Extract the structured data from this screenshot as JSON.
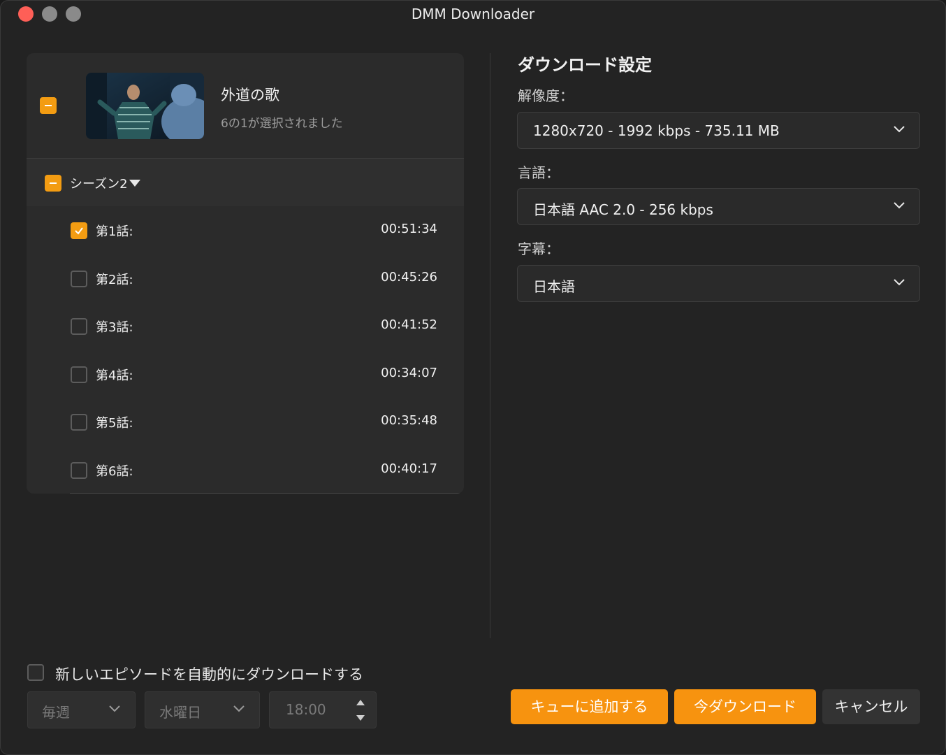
{
  "window": {
    "title": "DMM Downloader"
  },
  "show": {
    "title": "外道の歌",
    "selection_status": "6の1が選択されました",
    "season_label": "シーズン2"
  },
  "episodes": [
    {
      "label": "第1話:",
      "duration": "00:51:34",
      "checked": true
    },
    {
      "label": "第2話:",
      "duration": "00:45:26",
      "checked": false
    },
    {
      "label": "第3話:",
      "duration": "00:41:52",
      "checked": false
    },
    {
      "label": "第4話:",
      "duration": "00:34:07",
      "checked": false
    },
    {
      "label": "第5話:",
      "duration": "00:35:48",
      "checked": false
    },
    {
      "label": "第6話:",
      "duration": "00:40:17",
      "checked": false
    }
  ],
  "settings": {
    "title": "ダウンロード設定",
    "resolution_label": "解像度：",
    "resolution_value": "1280x720 - 1992 kbps - 735.11 MB",
    "language_label": "言語：",
    "language_value": "日本語 AAC 2.0 - 256 kbps",
    "subtitle_label": "字幕：",
    "subtitle_value": "日本語"
  },
  "auto_download": {
    "label": "新しいエピソードを自動的にダウンロードする",
    "frequency": "毎週",
    "day": "水曜日",
    "time": "18:00"
  },
  "buttons": {
    "queue": "キューに追加する",
    "download_now": "今ダウンロード",
    "cancel": "キャンセル"
  },
  "colors": {
    "accent": "#f7930f",
    "close": "#fe5f57"
  }
}
